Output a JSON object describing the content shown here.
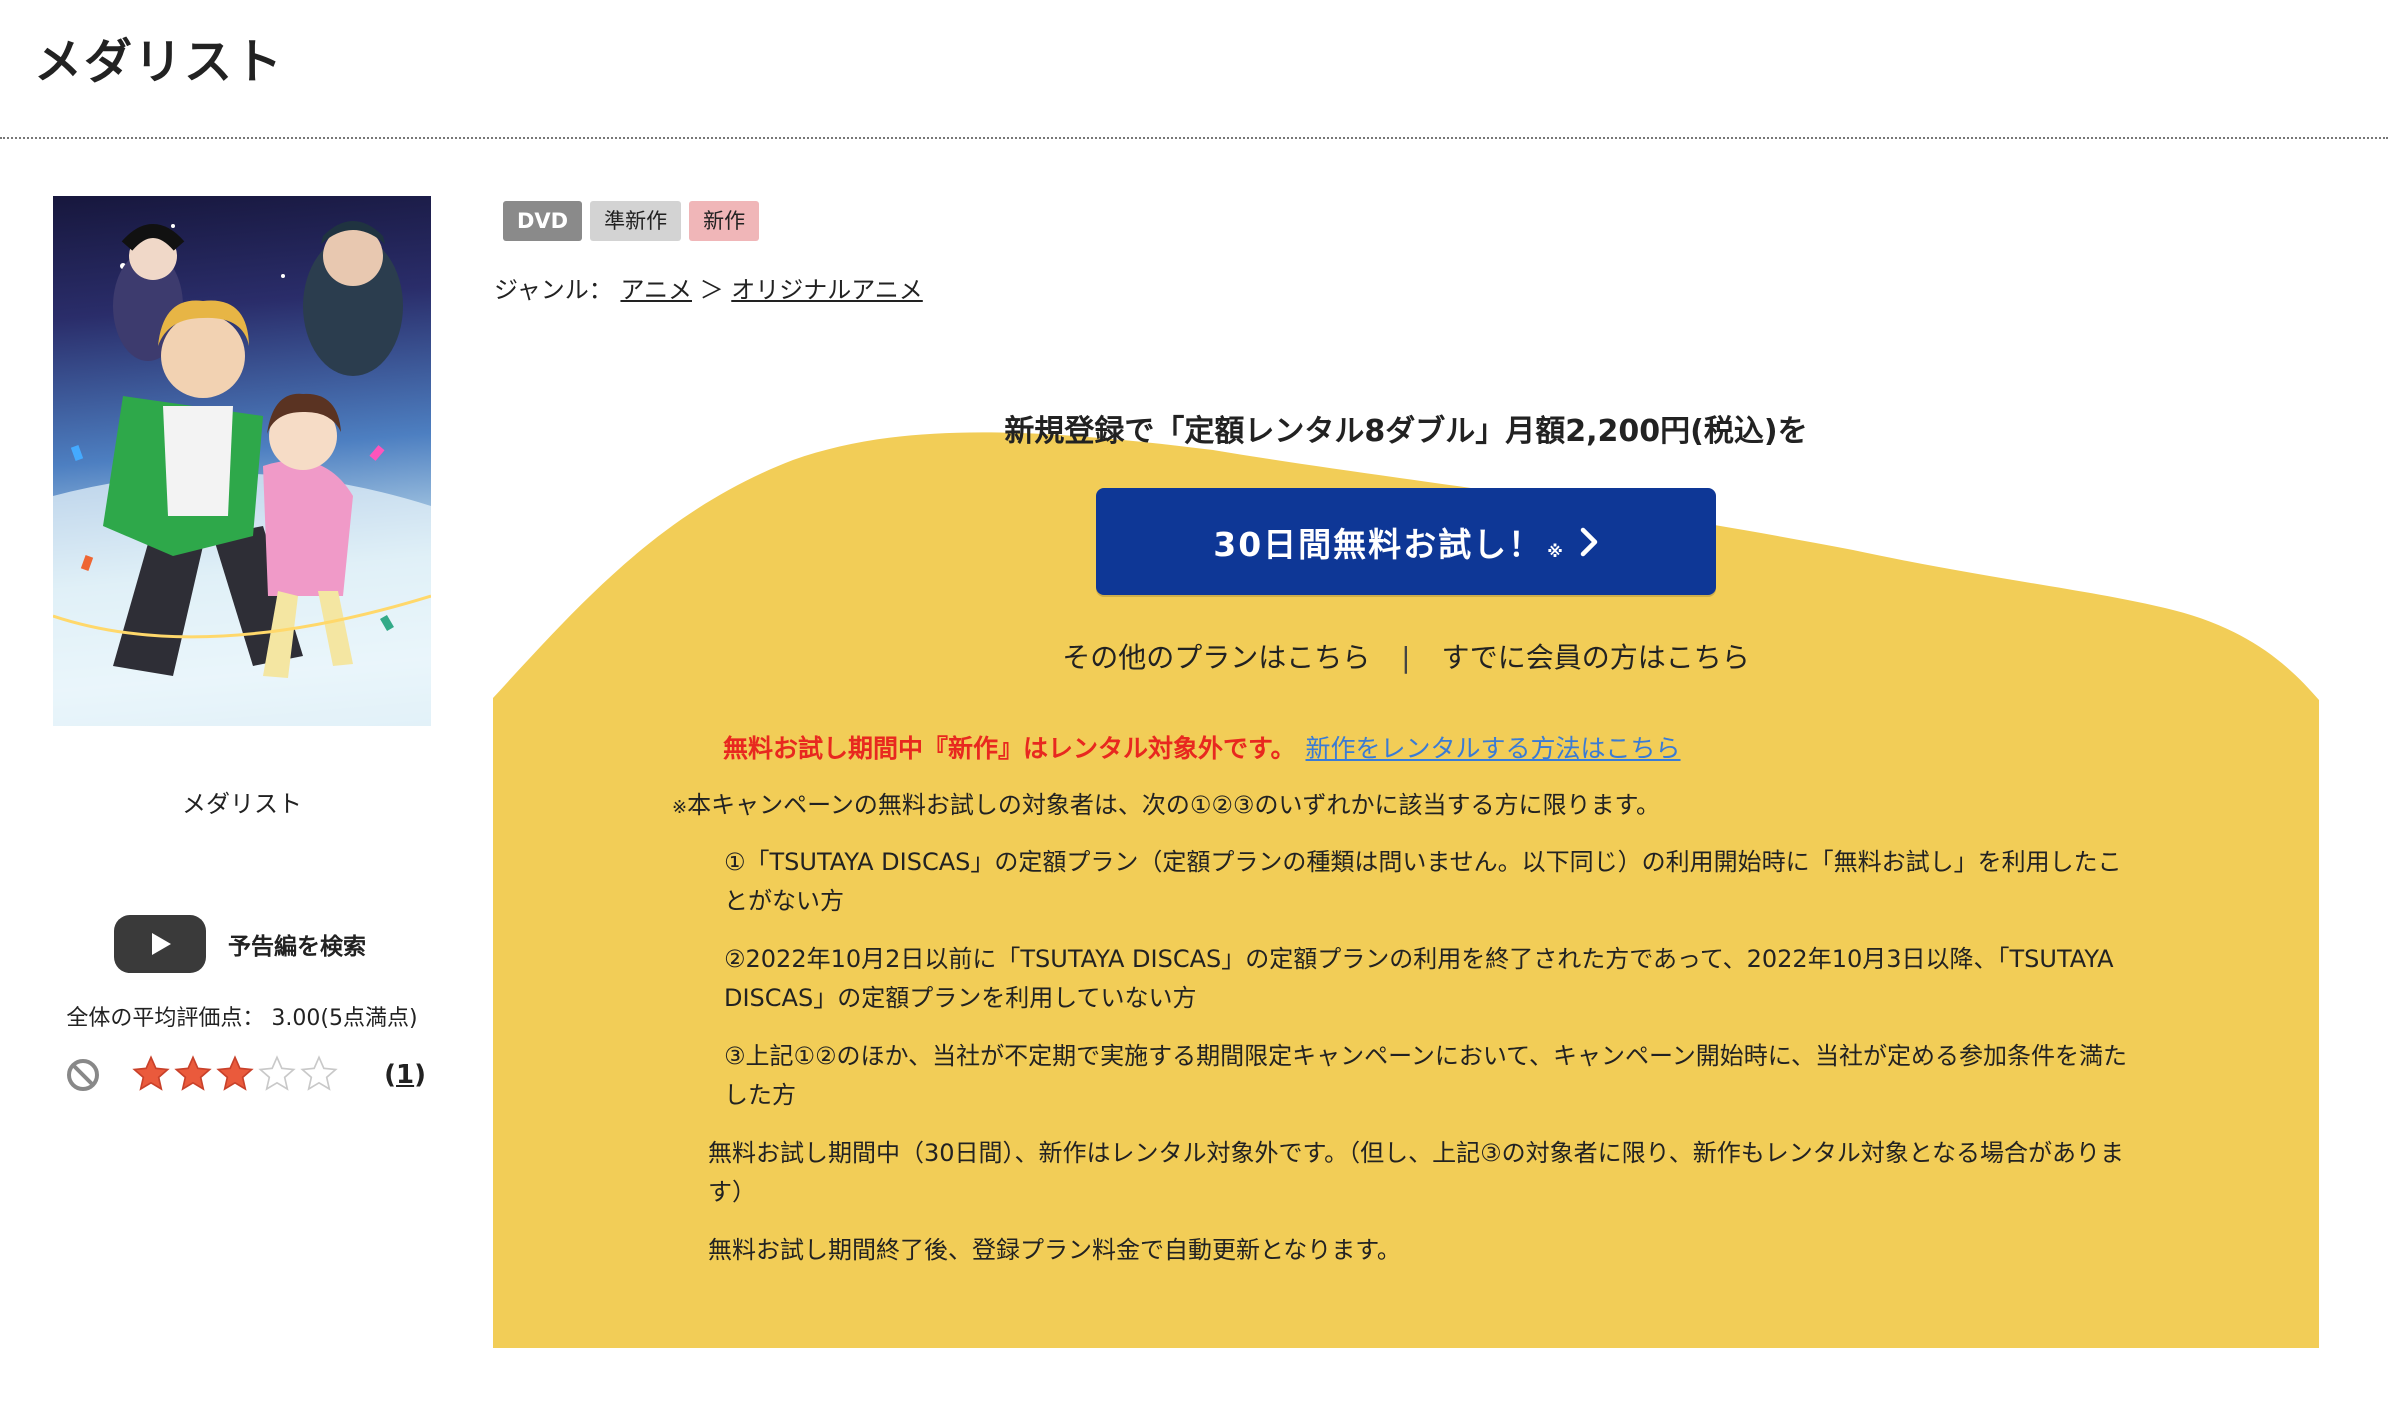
{
  "page": {
    "title": "メダリスト"
  },
  "product": {
    "caption": "メダリスト",
    "trailer_label": "予告編を検索",
    "rating_text": "全体の平均評価点： 3.00(5点満点)",
    "rating_value": 3,
    "rating_max": 5,
    "review_count": "1",
    "review_open": "(",
    "review_close": ")"
  },
  "badges": [
    {
      "label": "DVD"
    },
    {
      "label": "準新作"
    },
    {
      "label": "新作"
    }
  ],
  "genre": {
    "prefix": "ジャンル：",
    "items": [
      {
        "label": "アニメ"
      },
      {
        "label": "オリジナルアニメ"
      }
    ],
    "separator": "＞"
  },
  "promo": {
    "headline": "新規登録で「定額レンタル8ダブル」月額2,200円(税込)を",
    "cta_label": "30日間無料お試し！",
    "cta_mark": "※",
    "other_plans": "その他のプランはこちら",
    "divider": "|",
    "members": "すでに会員の方はこちら",
    "notice_red": "無料お試し期間中『新作』はレンタル対象外です。",
    "notice_link": "新作をレンタルする方法はこちら"
  },
  "fineprint": {
    "intro_mark": "※",
    "intro": "本キャンペーンの無料お試しの対象者は、次の①②③のいずれかに該当する方に限ります。",
    "item1": "①「TSUTAYA DISCAS」の定額プラン（定額プランの種類は問いません。以下同じ）の利用開始時に「無料お試し」を利用したことがない方",
    "item2": "②2022年10月2日以前に「TSUTAYA DISCAS」の定額プランの利用を終了された方であって、2022年10月3日以降、「TSUTAYA DISCAS」の定額プランを利用していない方",
    "item3": "③上記①②のほか、当社が不定期で実施する期間限定キャンペーンにおいて、キャンペーン開始時に、当社が定める参加条件を満たした方",
    "note1": "無料お試し期間中（30日間）、新作はレンタル対象外です。（但し、上記③の対象者に限り、新作もレンタル対象となる場合があります）",
    "note2": "無料お試し期間終了後、登録プラン料金で自動更新となります。"
  },
  "colors": {
    "promo_yellow": "#f2cd57",
    "cta_blue": "#0e3796",
    "notice_red": "#e8281f",
    "link_blue": "#3a7bd5"
  }
}
